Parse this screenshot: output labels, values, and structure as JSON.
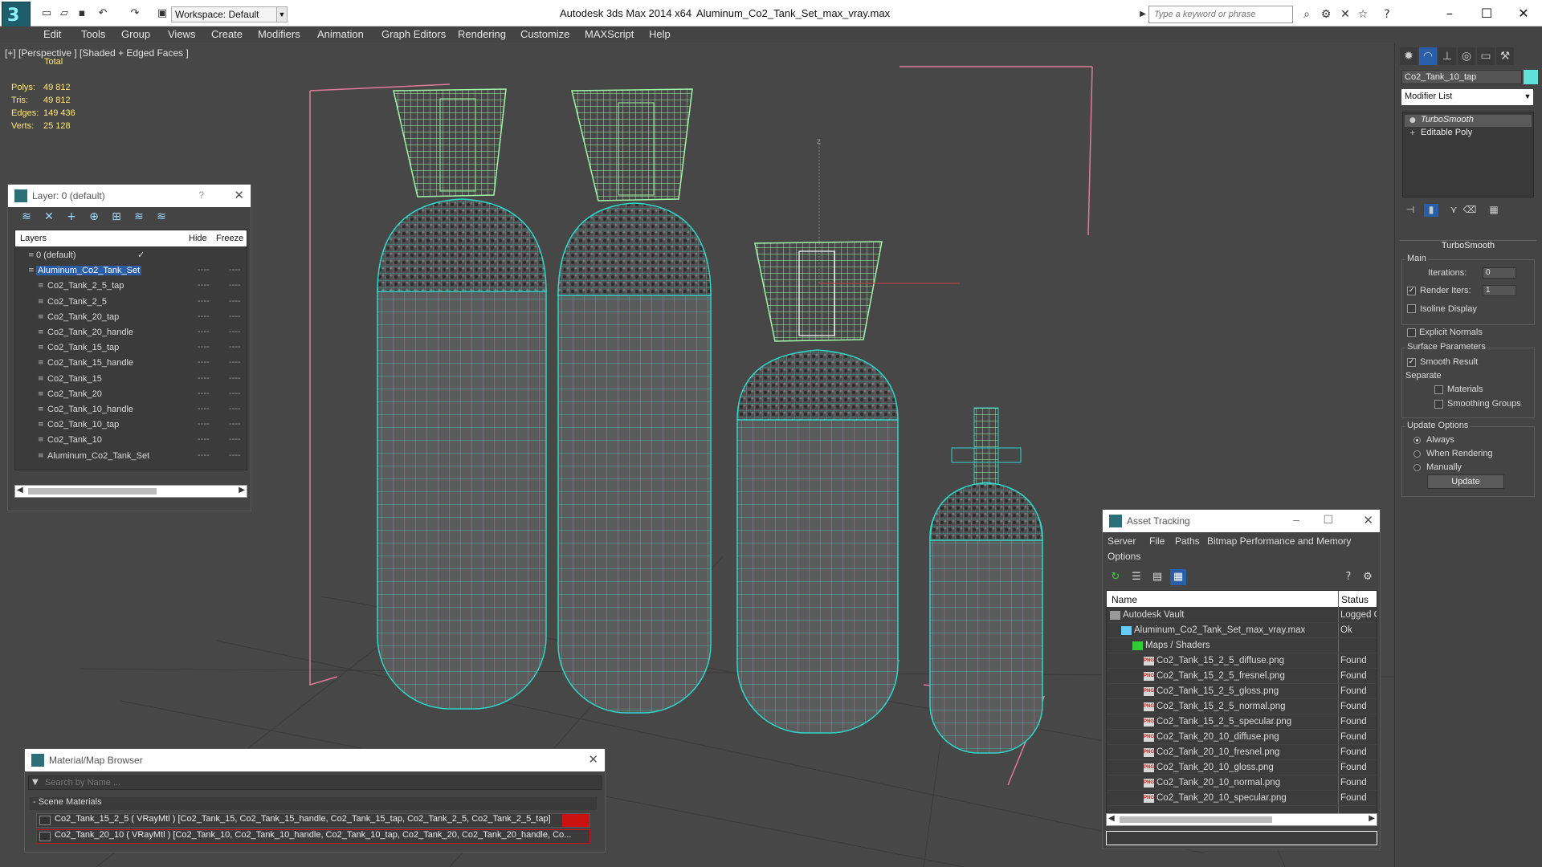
{
  "title_bar": {
    "app_title": "Autodesk 3ds Max  2014 x64",
    "file_title": "Aluminum_Co2_Tank_Set_max_vray.max",
    "workspace": "Workspace: Default",
    "search_placeholder": "Type a keyword or phrase"
  },
  "menu": [
    "Edit",
    "Tools",
    "Group",
    "Views",
    "Create",
    "Modifiers",
    "Animation",
    "Graph Editors",
    "Rendering",
    "Customize",
    "MAXScript",
    "Help"
  ],
  "viewport": {
    "label": "[+] [Perspective ] [Shaded + Edged Faces ]",
    "stats": {
      "total_label": "Total",
      "rows": [
        {
          "k": "Polys:",
          "v": "49 812"
        },
        {
          "k": "Tris:",
          "v": "49 812"
        },
        {
          "k": "Edges:",
          "v": "149 436"
        },
        {
          "k": "Verts:",
          "v": "25 128"
        }
      ]
    },
    "axis_label": "z"
  },
  "layers_window": {
    "title": "Layer: 0 (default)",
    "help": "?",
    "columns": {
      "layers": "Layers",
      "hide": "Hide",
      "freeze": "Freeze"
    },
    "rows": [
      {
        "name": "0 (default)",
        "level": 0,
        "checked": true
      },
      {
        "name": "Aluminum_Co2_Tank_Set",
        "level": 0,
        "selected": true
      },
      {
        "name": "Co2_Tank_2_5_tap",
        "level": 1
      },
      {
        "name": "Co2_Tank_2_5",
        "level": 1
      },
      {
        "name": "Co2_Tank_20_tap",
        "level": 1
      },
      {
        "name": "Co2_Tank_20_handle",
        "level": 1
      },
      {
        "name": "Co2_Tank_15_tap",
        "level": 1
      },
      {
        "name": "Co2_Tank_15_handle",
        "level": 1
      },
      {
        "name": "Co2_Tank_15",
        "level": 1
      },
      {
        "name": "Co2_Tank_20",
        "level": 1
      },
      {
        "name": "Co2_Tank_10_handle",
        "level": 1
      },
      {
        "name": "Co2_Tank_10_tap",
        "level": 1
      },
      {
        "name": "Co2_Tank_10",
        "level": 1
      },
      {
        "name": "Aluminum_Co2_Tank_Set",
        "level": 1
      }
    ],
    "dash": "----"
  },
  "command_panel": {
    "object_name": "Co2_Tank_10_tap",
    "object_color": "#5fe0d8",
    "modifier_list": "Modifier List",
    "stack": [
      {
        "name": "TurboSmooth",
        "active": true
      },
      {
        "name": "Editable Poly",
        "active": false
      }
    ],
    "turbosmooth": {
      "title": "TurboSmooth",
      "main": "Main",
      "iterations_label": "Iterations:",
      "iterations": "0",
      "render_iters_label": "Render Iters:",
      "render_iters": "1",
      "isoline": "Isoline Display",
      "explicit": "Explicit Normals",
      "surface": "Surface Parameters",
      "smooth_result": "Smooth Result",
      "separate": "Separate",
      "materials": "Materials",
      "smoothing_groups": "Smoothing Groups",
      "update_options": "Update Options",
      "always": "Always",
      "when_rendering": "When Rendering",
      "manually": "Manually",
      "update": "Update"
    }
  },
  "asset_tracking": {
    "title": "Asset Tracking",
    "menu": [
      "Server",
      "File",
      "Paths",
      "Bitmap Performance and Memory",
      "Options"
    ],
    "columns": {
      "name": "Name",
      "status": "Status"
    },
    "rows": [
      {
        "name": "Autodesk Vault",
        "status": "Logged Out",
        "level": 0
      },
      {
        "name": "Aluminum_Co2_Tank_Set_max_vray.max",
        "status": "Ok",
        "level": 1
      },
      {
        "name": "Maps / Shaders",
        "status": "",
        "level": 2
      },
      {
        "name": "Co2_Tank_15_2_5_diffuse.png",
        "status": "Found",
        "level": 3
      },
      {
        "name": "Co2_Tank_15_2_5_fresnel.png",
        "status": "Found",
        "level": 3
      },
      {
        "name": "Co2_Tank_15_2_5_gloss.png",
        "status": "Found",
        "level": 3
      },
      {
        "name": "Co2_Tank_15_2_5_normal.png",
        "status": "Found",
        "level": 3
      },
      {
        "name": "Co2_Tank_15_2_5_specular.png",
        "status": "Found",
        "level": 3
      },
      {
        "name": "Co2_Tank_20_10_diffuse.png",
        "status": "Found",
        "level": 3
      },
      {
        "name": "Co2_Tank_20_10_fresnel.png",
        "status": "Found",
        "level": 3
      },
      {
        "name": "Co2_Tank_20_10_gloss.png",
        "status": "Found",
        "level": 3
      },
      {
        "name": "Co2_Tank_20_10_normal.png",
        "status": "Found",
        "level": 3
      },
      {
        "name": "Co2_Tank_20_10_specular.png",
        "status": "Found",
        "level": 3
      }
    ]
  },
  "material_browser": {
    "title": "Material/Map Browser",
    "search_placeholder": "Search by Name ...",
    "section": "- Scene Materials",
    "materials": [
      "Co2_Tank_15_2_5  ( VRayMtl ) [Co2_Tank_15, Co2_Tank_15_handle, Co2_Tank_15_tap, Co2_Tank_2_5, Co2_Tank_2_5_tap]",
      "Co2_Tank_20_10  ( VRayMtl ) [Co2_Tank_10, Co2_Tank_10_handle, Co2_Tank_10_tap, Co2_Tank_20, Co2_Tank_20_handle, Co..."
    ]
  },
  "colors": {
    "wire": "#2fd6c6",
    "selected_wire": "#9ff5a6",
    "bbox": "#e07a9a",
    "stats": "#ffe77a"
  }
}
